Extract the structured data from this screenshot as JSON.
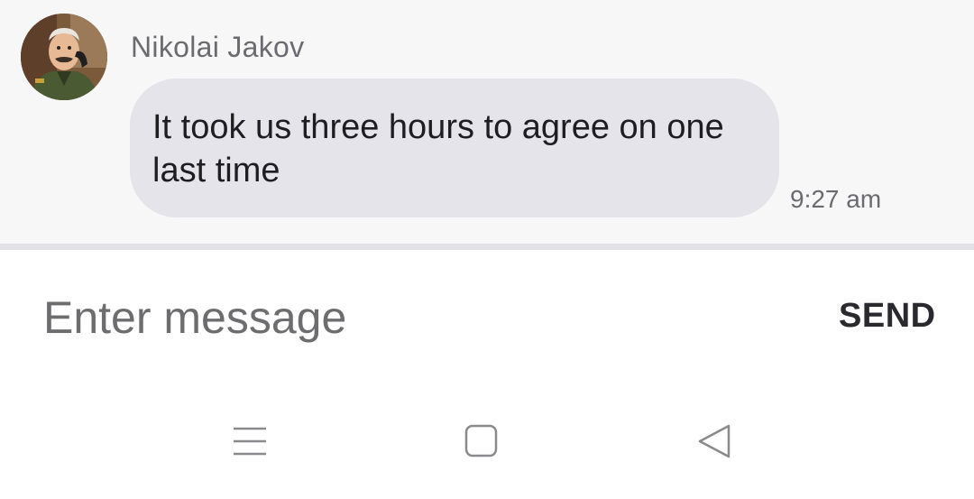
{
  "message": {
    "sender_name": "Nikolai Jakov",
    "text": "It took us three hours to agree on one last time",
    "timestamp": "9:27 am",
    "avatar_icon": "profile-avatar"
  },
  "composer": {
    "placeholder": "Enter message",
    "send_label": "SEND"
  },
  "navbar": {
    "menu_icon": "menu-icon",
    "home_icon": "home-square-icon",
    "back_icon": "back-triangle-icon"
  },
  "colors": {
    "chat_background": "#f7f7f8",
    "bubble": "#e4e4ea",
    "divider": "#e2e2e6",
    "text_primary": "#1e1e22",
    "text_secondary": "#6b6b6f"
  }
}
